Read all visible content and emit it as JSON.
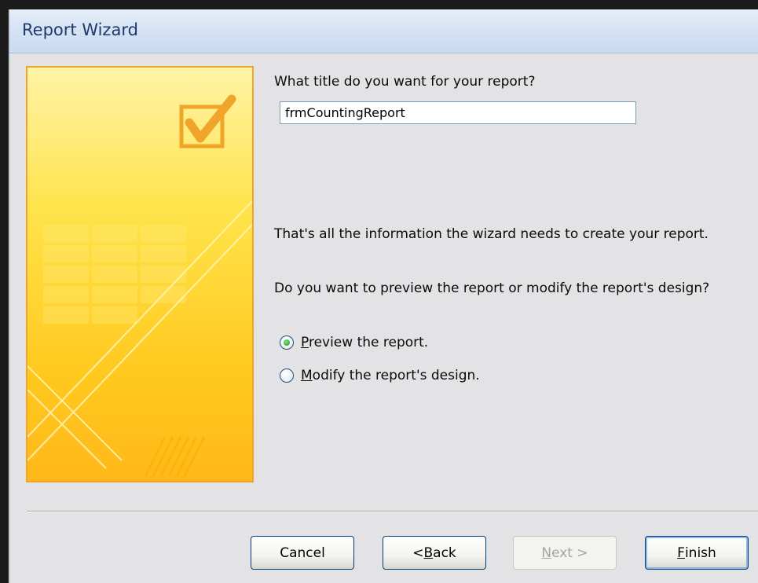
{
  "window": {
    "title": "Report Wizard"
  },
  "content": {
    "title_prompt": "What title do you want for your report?",
    "title_value": "frmCountingReport",
    "info_text": "That's all the information the wizard needs to create your report.",
    "question_text": "Do you want to preview the report or modify the report's design?",
    "options": [
      {
        "prefix": "",
        "accel": "P",
        "rest": "review the report.",
        "checked": true
      },
      {
        "prefix": "",
        "accel": "M",
        "rest": "odify the report's design.",
        "checked": false
      }
    ]
  },
  "buttons": {
    "cancel": {
      "label": "Cancel"
    },
    "back": {
      "prefix": "< ",
      "accel": "B",
      "rest": "ack"
    },
    "next": {
      "accel": "N",
      "rest": "ext >",
      "disabled": true
    },
    "finish": {
      "accel": "F",
      "rest": "inish"
    }
  },
  "colors": {
    "titlebar": "#d6e3f3",
    "title_text": "#1e3a6e",
    "dialog_bg": "#e3e3e6",
    "accent_orange": "#f0a42a",
    "accent_yellow": "#ffd21e"
  }
}
